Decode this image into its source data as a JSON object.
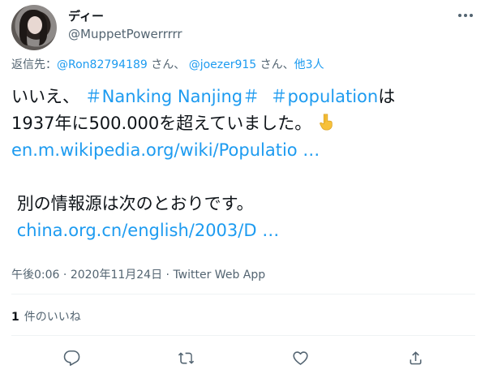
{
  "author": {
    "display_name": "ディー",
    "handle": "@MuppetPowerrrrr"
  },
  "reply": {
    "prefix": "返信先：",
    "user1": "@Ron82794189",
    "suffix1": " さん、 ",
    "user2": "@joezer915",
    "suffix2": " さん、",
    "others": "他3人"
  },
  "tweet": {
    "line1_text": "いいえ、 ",
    "hashtag1": "＃Nanking  Nanjing＃",
    "hashtag2": "＃population",
    "line1_tail": "は",
    "line2_text": "1937年に500.000を超えていました。 ",
    "link1": "en.m.wikipedia.org/wiki/Populatio …",
    "line4_text": "別の情報源は次のとおりです。",
    "link2": "china.org.cn/english/2003/D …"
  },
  "meta": {
    "time": "午後0:06",
    "sep1": " · ",
    "date": "2020年11月24日",
    "sep2": " · ",
    "source": "Twitter Web App"
  },
  "likes": {
    "count": "1",
    "label": "件のいいね"
  },
  "icons": {
    "more": "more-icon",
    "reply": "reply-icon",
    "retweet": "retweet-icon",
    "like": "like-icon",
    "share": "share-icon",
    "emoji": "pointing-down-icon"
  },
  "colors": {
    "link": "#1d9bf0",
    "secondary_text": "#536471",
    "primary_text": "#0f1419"
  }
}
